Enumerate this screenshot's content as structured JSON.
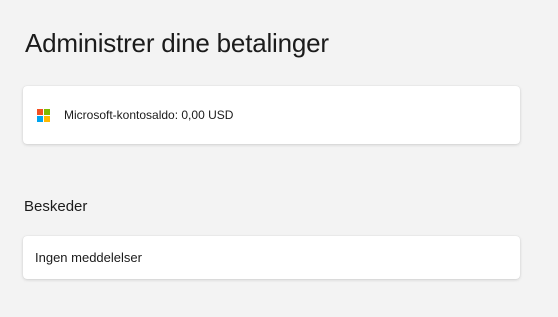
{
  "page": {
    "title": "Administrer dine betalinger"
  },
  "balance_card": {
    "icon": "microsoft-logo-icon",
    "logo_colors": [
      "#f25022",
      "#7fba00",
      "#00a4ef",
      "#ffb900"
    ],
    "text": "Microsoft-kontosaldo: 0,00 USD"
  },
  "messages": {
    "heading": "Beskeder",
    "empty_text": "Ingen meddelelser"
  }
}
